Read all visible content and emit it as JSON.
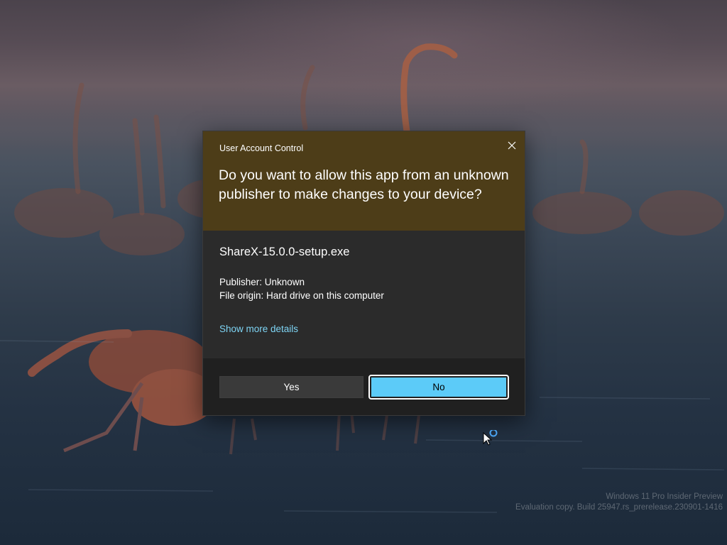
{
  "wallpaper": {
    "description_icon": "flamingo-wallpaper"
  },
  "uac": {
    "window_title": "User Account Control",
    "question": "Do you want to allow this app from an unknown publisher to make changes to your device?",
    "app_name": "ShareX-15.0.0-setup.exe",
    "publisher": "Publisher: Unknown",
    "file_origin": "File origin: Hard drive on this computer",
    "details_link": "Show more details",
    "yes_label": "Yes",
    "no_label": "No",
    "close_icon": "close-icon",
    "colors": {
      "header": "#4d3d18",
      "body": "#2b2b2b",
      "footer": "#202020",
      "accent": "#5ccbf8",
      "link": "#7ed4f4"
    }
  },
  "watermark": {
    "line1": "Windows 11 Pro Insider Preview",
    "line2": "Evaluation copy. Build 25947.rs_prerelease.230901-1416"
  },
  "cursor": {
    "icon": "busy-pointer-icon"
  }
}
